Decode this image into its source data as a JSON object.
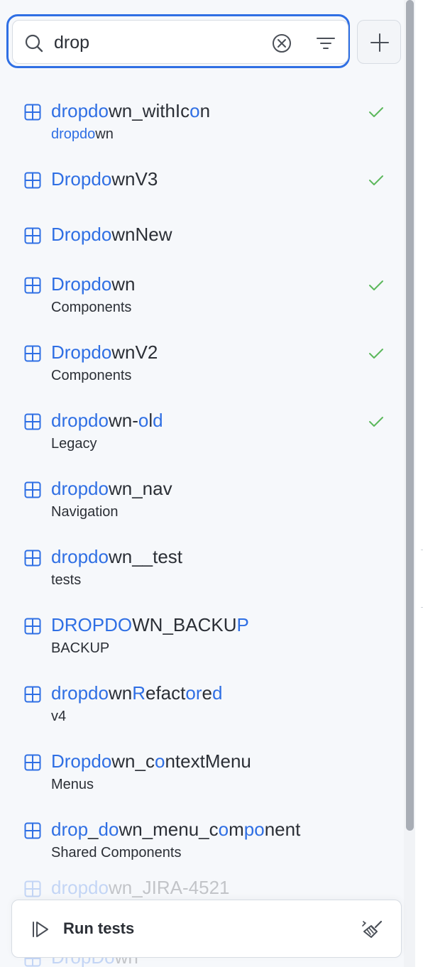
{
  "search": {
    "value": "drop",
    "placeholder": "Search"
  },
  "icons": {
    "search": "search-icon",
    "clear": "clear-circle-x-icon",
    "filter": "filter-lines-icon",
    "add": "plus-icon",
    "item": "grid-square-icon",
    "check": "check-icon",
    "run": "play-bar-icon",
    "clean": "broom-icon"
  },
  "colors": {
    "accent": "#2f6fe4",
    "check": "#5cb85c",
    "text": "#2b2f36",
    "background": "#f6f8fb"
  },
  "items": [
    {
      "name": [
        [
          "dropdo",
          true
        ],
        [
          "wn_withIc",
          false
        ],
        [
          "o",
          true
        ],
        [
          "n",
          false
        ]
      ],
      "sub": [
        [
          "dropdo",
          true
        ],
        [
          "wn",
          false
        ]
      ],
      "checked": true
    },
    {
      "name": [
        [
          "Dropdo",
          true
        ],
        [
          "wnV3",
          false
        ]
      ],
      "sub": [],
      "checked": true
    },
    {
      "name": [
        [
          "Dropdo",
          true
        ],
        [
          "wnNew",
          false
        ]
      ],
      "sub": [],
      "checked": false
    },
    {
      "name": [
        [
          "Dropdo",
          true
        ],
        [
          "wn",
          false
        ]
      ],
      "sub": [
        [
          "Components",
          false
        ]
      ],
      "checked": true
    },
    {
      "name": [
        [
          "Dropdo",
          true
        ],
        [
          "wnV2",
          false
        ]
      ],
      "sub": [
        [
          "Components",
          false
        ]
      ],
      "checked": true
    },
    {
      "name": [
        [
          "dropdo",
          true
        ],
        [
          "wn-",
          false
        ],
        [
          "o",
          true
        ],
        [
          "l",
          false
        ],
        [
          "d",
          true
        ]
      ],
      "sub": [
        [
          "Legacy",
          false
        ]
      ],
      "checked": true
    },
    {
      "name": [
        [
          "dropdo",
          true
        ],
        [
          "wn_nav",
          false
        ]
      ],
      "sub": [
        [
          "Navigation",
          false
        ]
      ],
      "checked": false
    },
    {
      "name": [
        [
          "dropdo",
          true
        ],
        [
          "wn__test",
          false
        ]
      ],
      "sub": [
        [
          "tests",
          false
        ]
      ],
      "checked": false
    },
    {
      "name": [
        [
          "DROPDO",
          true
        ],
        [
          "WN_BACKU",
          false
        ],
        [
          "P",
          true
        ]
      ],
      "sub": [
        [
          "BACKUP",
          false
        ]
      ],
      "checked": false
    },
    {
      "name": [
        [
          "dropdo",
          true
        ],
        [
          "wn",
          false
        ],
        [
          "R",
          true
        ],
        [
          "efact",
          false
        ],
        [
          "or",
          true
        ],
        [
          "e",
          false
        ],
        [
          "d",
          true
        ]
      ],
      "sub": [
        [
          "v4",
          false
        ]
      ],
      "checked": false
    },
    {
      "name": [
        [
          "Dropdo",
          true
        ],
        [
          "wn_c",
          false
        ],
        [
          "o",
          true
        ],
        [
          "ntextMenu",
          false
        ]
      ],
      "sub": [
        [
          "Menus",
          false
        ]
      ],
      "checked": false
    },
    {
      "name": [
        [
          "drop",
          true
        ],
        [
          "_",
          false
        ],
        [
          "do",
          true
        ],
        [
          "wn_menu_c",
          false
        ],
        [
          "o",
          true
        ],
        [
          "m",
          false
        ],
        [
          "po",
          true
        ],
        [
          "nent",
          false
        ]
      ],
      "sub": [
        [
          "Shared Components",
          false
        ]
      ],
      "checked": false
    },
    {
      "name": [
        [
          "dropdo",
          true
        ],
        [
          "wn_JIRA-4521",
          false
        ]
      ],
      "sub": [],
      "checked": false,
      "faded": true
    },
    {
      "name": [
        [
          "DropDo",
          true
        ],
        [
          "wn",
          false
        ]
      ],
      "sub": [],
      "checked": false,
      "faded": true
    }
  ],
  "footer": {
    "run_label": "Run tests"
  }
}
